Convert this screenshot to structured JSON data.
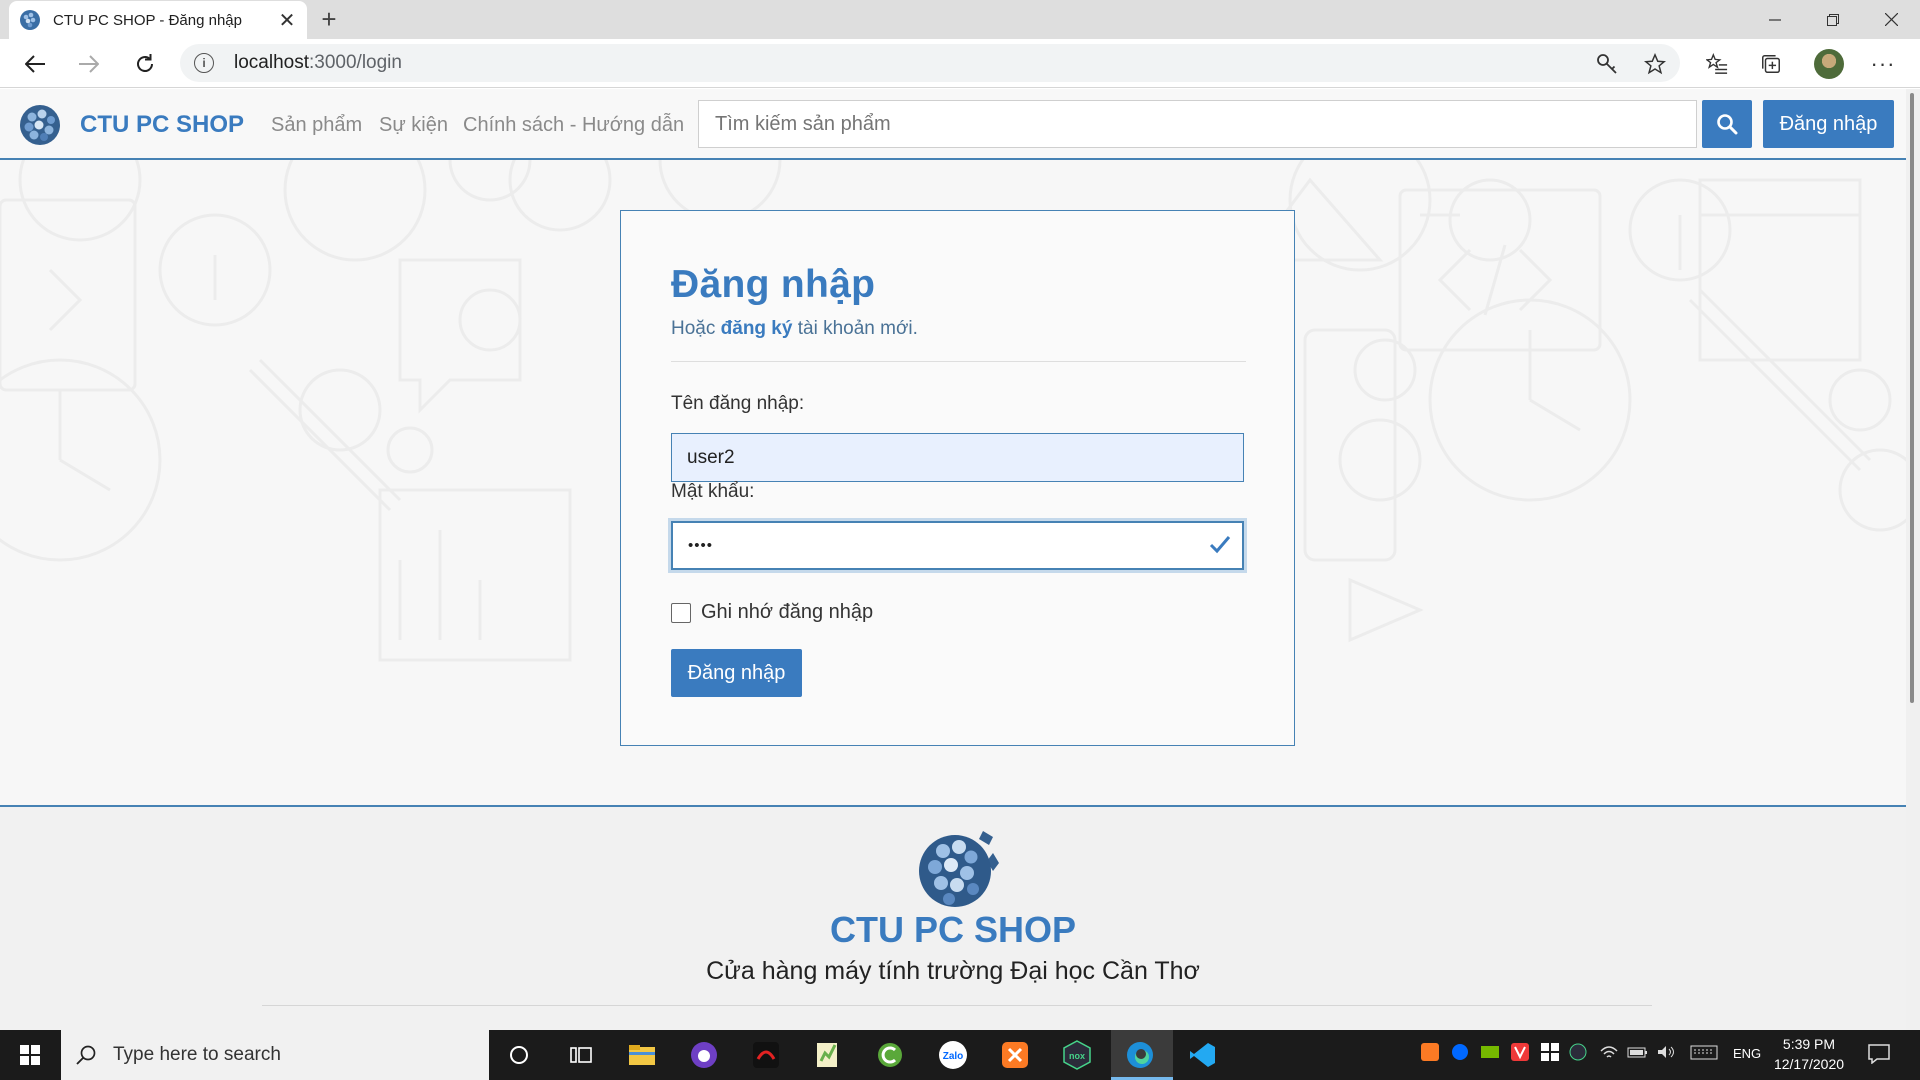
{
  "browser": {
    "tab_title": "CTU PC SHOP - Đăng nhập",
    "new_tab_symbol": "+",
    "url_host": "localhost",
    "url_path": ":3000/login",
    "window_controls": [
      "minimize",
      "restore",
      "close"
    ]
  },
  "header": {
    "brand": "CTU PC SHOP",
    "nav": [
      "Sản phẩm",
      "Sự kiện",
      "Chính sách - Hướng dẫn"
    ],
    "search_placeholder": "Tìm kiếm sản phẩm",
    "login_button": "Đăng nhập"
  },
  "login_form": {
    "title": "Đăng nhập",
    "subtitle_prefix": "Hoặc",
    "subtitle_link": "đăng ký",
    "subtitle_suffix": "tài khoản mới.",
    "username_label": "Tên đăng nhập:",
    "username_value": "user2",
    "password_label": "Mật khẩu:",
    "password_masked": "••••",
    "remember_label": "Ghi nhớ đăng nhập",
    "remember_checked": false,
    "submit_label": "Đăng nhập"
  },
  "footer": {
    "brand": "CTU PC SHOP",
    "tagline": "Cửa hàng máy tính trường Đại học Cần Thơ"
  },
  "taskbar": {
    "search_placeholder": "Type here to search",
    "language": "ENG",
    "time": "5:39 PM",
    "date": "12/17/2020",
    "apps": [
      "cortana-icon",
      "task-view-icon",
      "file-explorer-icon",
      "github-desktop-icon",
      "garena-icon",
      "notepad-plus-icon",
      "cc-cleaner-icon",
      "zalo-icon",
      "xampp-icon",
      "nox-icon",
      "edge-icon",
      "vscode-icon"
    ]
  },
  "colors": {
    "brand_blue": "#3a7bbf",
    "border_blue": "#4682b4",
    "autofill_bg": "#e8f0fe"
  }
}
